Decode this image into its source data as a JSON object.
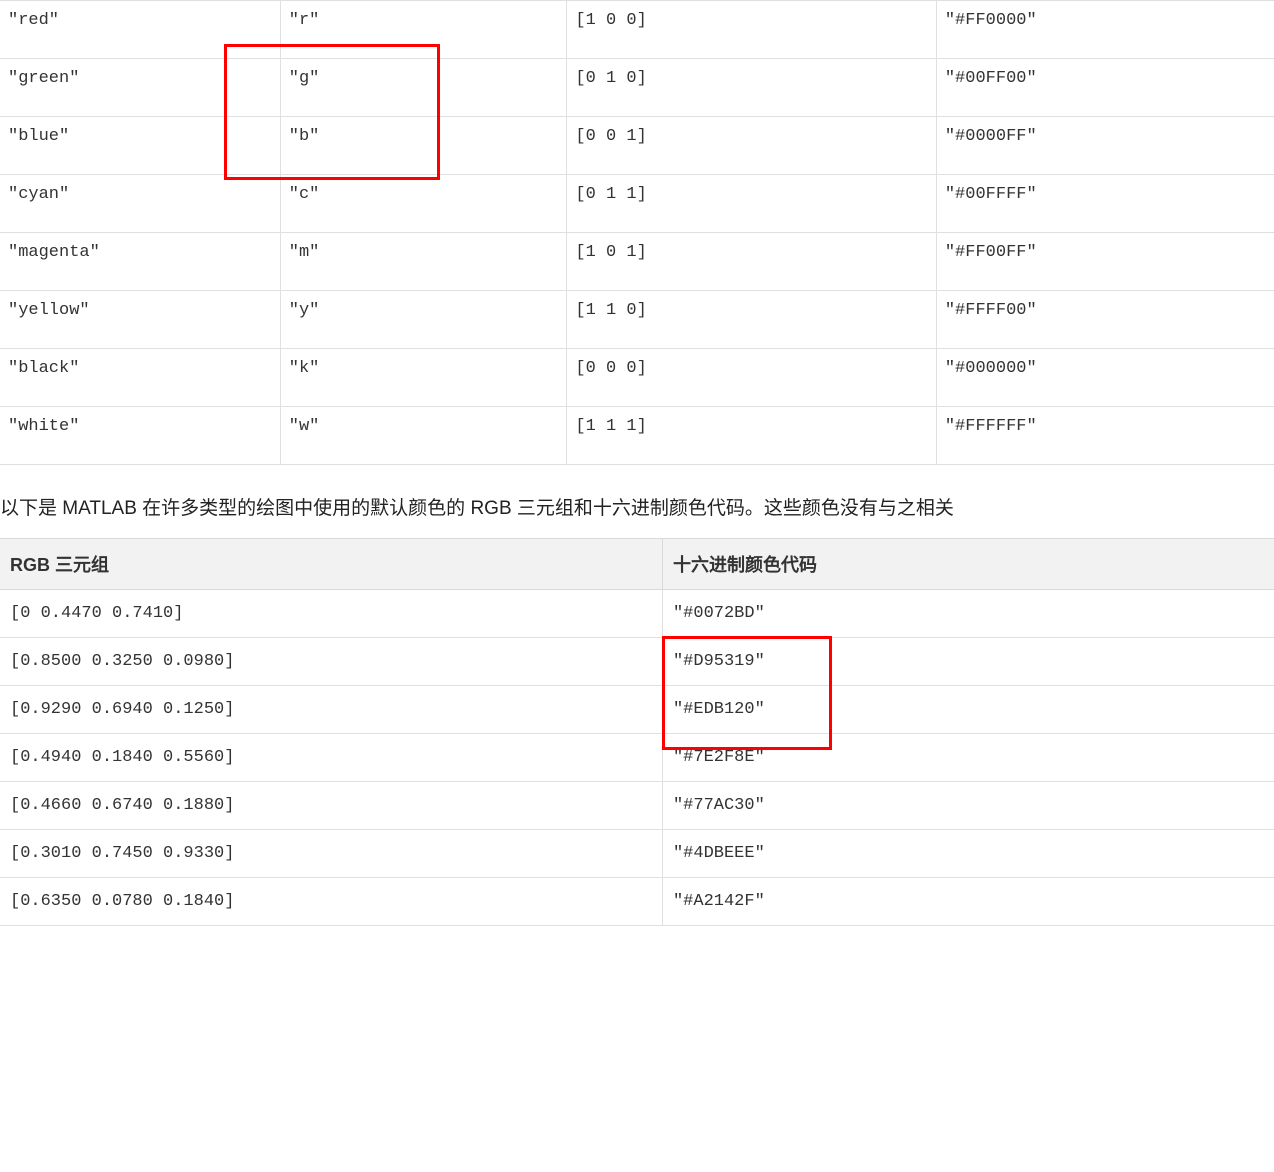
{
  "named_colors": [
    {
      "name": "\"red\"",
      "short": "\"r\"",
      "rgb": "[1 0 0]",
      "hex": "\"#FF0000\""
    },
    {
      "name": "\"green\"",
      "short": "\"g\"",
      "rgb": "[0 1 0]",
      "hex": "\"#00FF00\""
    },
    {
      "name": "\"blue\"",
      "short": "\"b\"",
      "rgb": "[0 0 1]",
      "hex": "\"#0000FF\""
    },
    {
      "name": "\"cyan\"",
      "short": "\"c\"",
      "rgb": "[0 1 1]",
      "hex": "\"#00FFFF\""
    },
    {
      "name": "\"magenta\"",
      "short": "\"m\"",
      "rgb": "[1 0 1]",
      "hex": "\"#FF00FF\""
    },
    {
      "name": "\"yellow\"",
      "short": "\"y\"",
      "rgb": "[1 1 0]",
      "hex": "\"#FFFF00\""
    },
    {
      "name": "\"black\"",
      "short": "\"k\"",
      "rgb": "[0 0 0]",
      "hex": "\"#000000\""
    },
    {
      "name": "\"white\"",
      "short": "\"w\"",
      "rgb": "[1 1 1]",
      "hex": "\"#FFFFFF\""
    }
  ],
  "description": "以下是 MATLAB 在许多类型的绘图中使用的默认颜色的 RGB 三元组和十六进制颜色代码。这些颜色没有与之相关",
  "default_table": {
    "header_rgb": "RGB 三元组",
    "header_hex": "十六进制颜色代码",
    "rows": [
      {
        "rgb": "[0 0.4470 0.7410]",
        "hex": "\"#0072BD\""
      },
      {
        "rgb": "[0.8500 0.3250 0.0980]",
        "hex": "\"#D95319\""
      },
      {
        "rgb": "[0.9290 0.6940 0.1250]",
        "hex": "\"#EDB120\""
      },
      {
        "rgb": "[0.4940 0.1840 0.5560]",
        "hex": "\"#7E2F8E\""
      },
      {
        "rgb": "[0.4660 0.6740 0.1880]",
        "hex": "\"#77AC30\""
      },
      {
        "rgb": "[0.3010 0.7450 0.9330]",
        "hex": "\"#4DBEEE\""
      },
      {
        "rgb": "[0.6350 0.0780 0.1840]",
        "hex": "\"#A2142F\""
      }
    ]
  }
}
